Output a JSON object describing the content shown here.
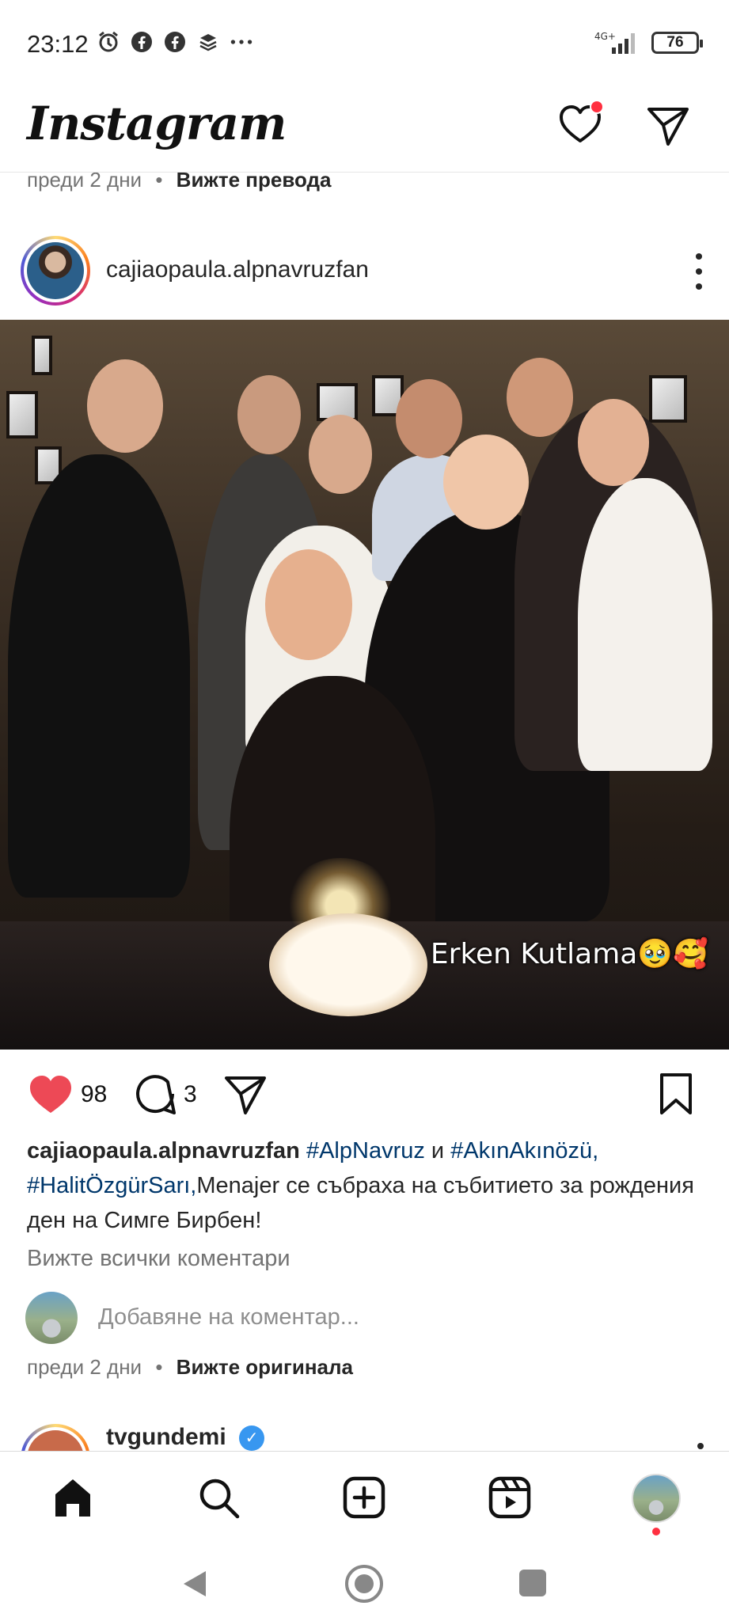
{
  "status_bar": {
    "time": "23:12",
    "icons": [
      "alarm-icon",
      "facebook-icon",
      "facebook-icon",
      "layers-icon",
      "more-dots-icon"
    ],
    "network": "4G+",
    "battery": "76"
  },
  "header": {
    "logo": "Instagram",
    "notification_dot_color": "#ff3040"
  },
  "previous_post": {
    "time": "преди 2 дни",
    "separator": "•",
    "translate_link": "Вижте превода"
  },
  "post": {
    "username": "cajiaopaula.alpnavruzfan",
    "photo_caption": "Erken Kutlama🥹🥰",
    "likes": "98",
    "comments": "3",
    "caption": {
      "user": "cajiaopaula.alpnavruzfan",
      "tag1": "#AlpNavruz",
      "and": "и",
      "tag2": "#AkınAkınözü,",
      "tag3": "#HalitÖzgürSarı,",
      "text": "Menajer се събраха на събитието за рождения ден на Симге Бирбен!"
    },
    "view_all_comments": "Вижте всички коментари",
    "add_comment_placeholder": "Добавяне на коментар...",
    "time": "преди 2 дни",
    "separator": "•",
    "original_link": "Вижте оригинала"
  },
  "next_post": {
    "username": "tvgundemi"
  },
  "bottom_nav": {
    "items": [
      "home-icon",
      "search-icon",
      "create-icon",
      "reels-icon",
      "profile-avatar"
    ]
  },
  "colors": {
    "like_red": "#ed4956",
    "hashtag_blue": "#00376b",
    "muted_text": "#737373",
    "verified_blue": "#3897f0"
  }
}
